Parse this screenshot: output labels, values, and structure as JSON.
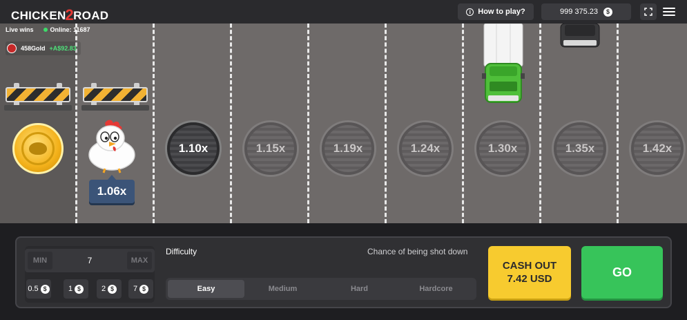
{
  "header": {
    "logo_part1": "CHICKEN",
    "logo_part2": "2",
    "logo_part3": "ROAD",
    "how_to_play": "How to play?",
    "balance": "999 375.23",
    "currency_icon": "$"
  },
  "live": {
    "live_wins": "Live wins",
    "online": "Online: 11687",
    "winner_name": "458Gold",
    "winner_amount": "+A$92.83"
  },
  "game": {
    "current_multiplier": "1.06x",
    "lanes": [
      "1.10x",
      "1.15x",
      "1.19x",
      "1.24x",
      "1.30x",
      "1.35x",
      "1.42x"
    ]
  },
  "controls": {
    "min_label": "MIN",
    "max_label": "MAX",
    "bet_value": "7",
    "quick_bets": [
      "0.5",
      "1",
      "2",
      "7"
    ],
    "difficulty_label": "Difficulty",
    "chance_label": "Chance of being shot down",
    "difficulties": [
      "Easy",
      "Medium",
      "Hard",
      "Hardcore"
    ],
    "selected_difficulty": "Easy",
    "cashout_line1": "CASH OUT",
    "cashout_line2": "7.42 USD",
    "go_label": "GO"
  },
  "colors": {
    "road": "#6e6a69",
    "cashout": "#f7cb2f",
    "go": "#37c45a",
    "multiplier_tag": "#3b5478"
  }
}
